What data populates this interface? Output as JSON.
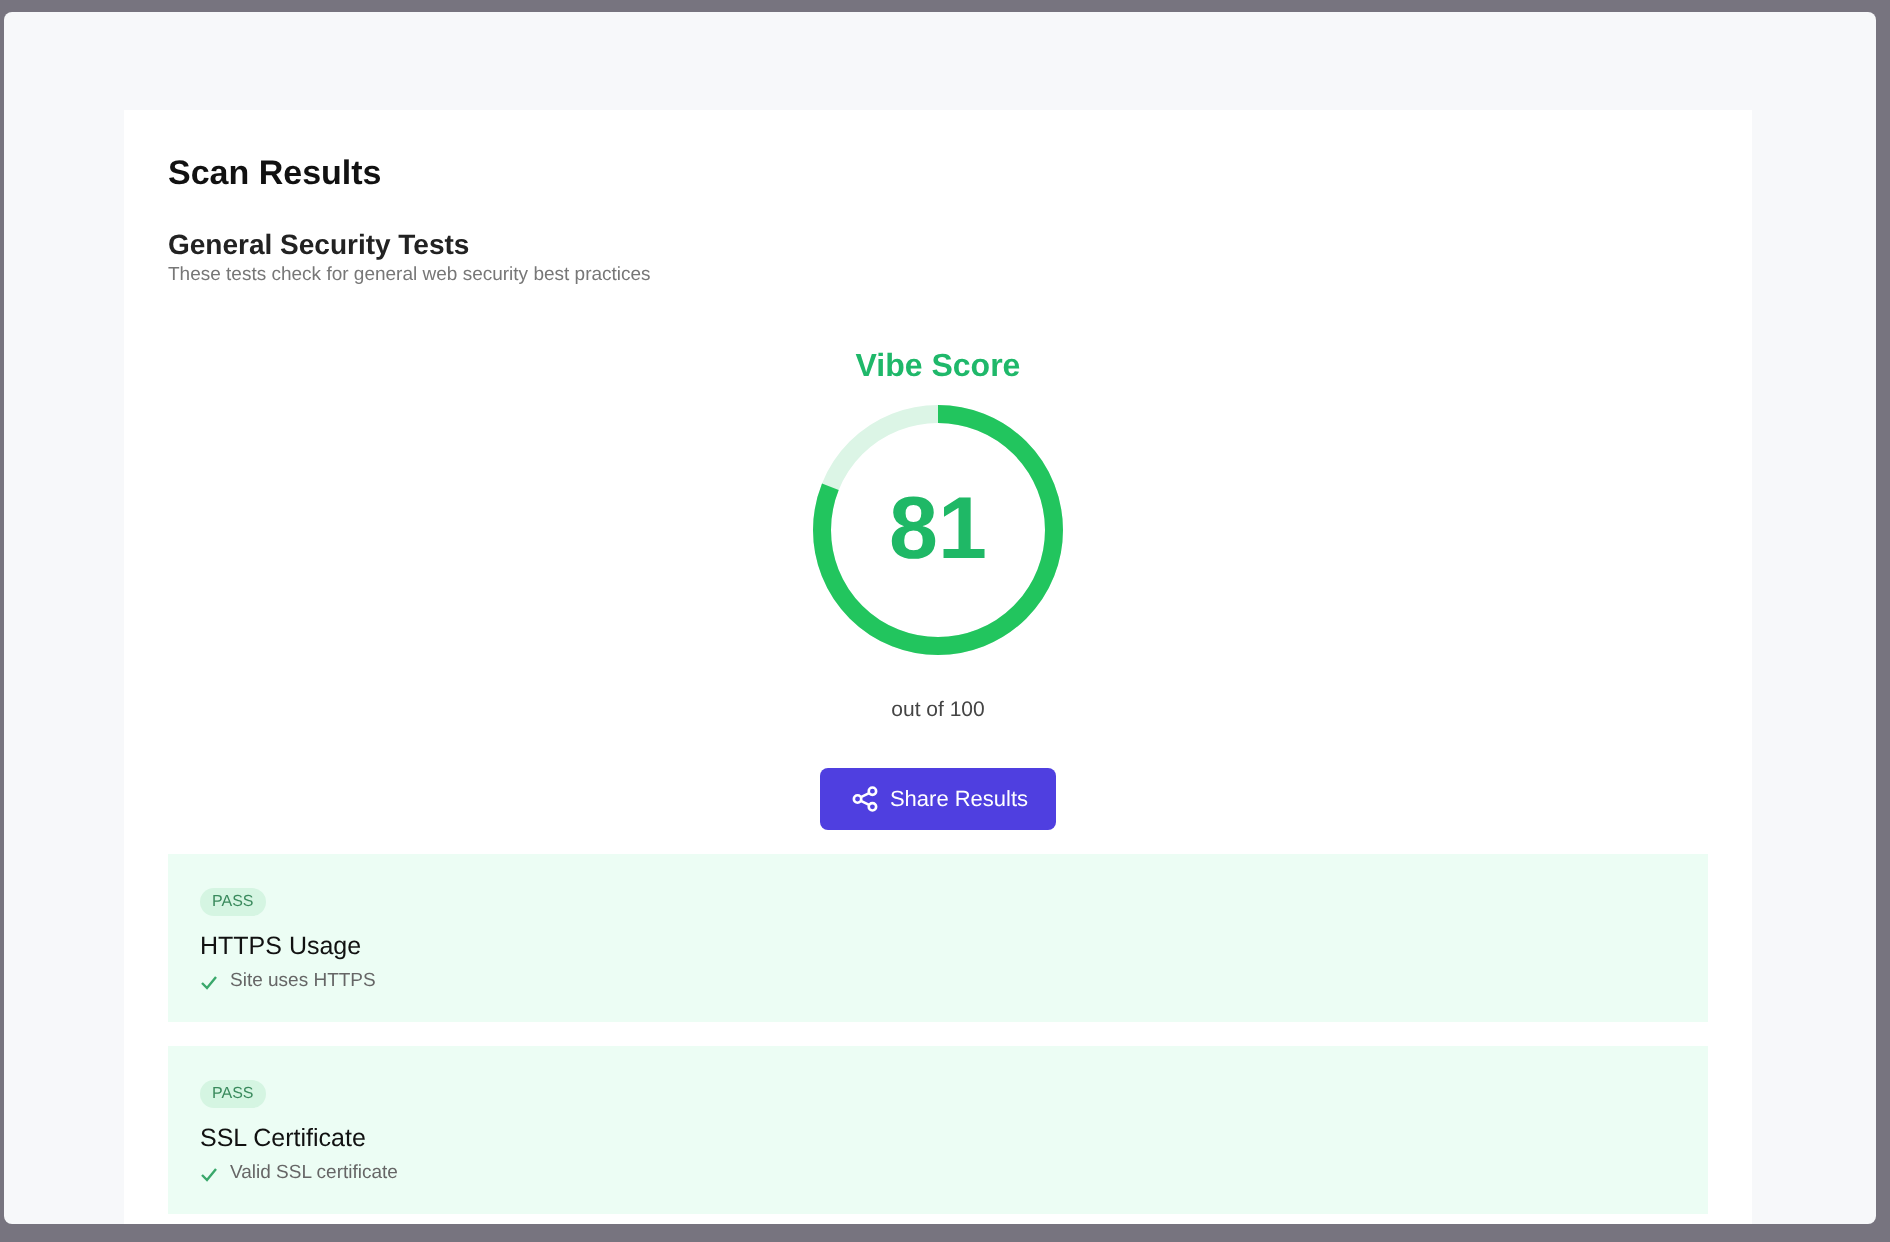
{
  "page": {
    "title": "Scan Results"
  },
  "section": {
    "title": "General Security Tests",
    "description": "These tests check for general web security best practices"
  },
  "score": {
    "label": "Vibe Score",
    "value": "81",
    "level": 0.81,
    "caption": "out of 100"
  },
  "share_button": {
    "label": "Share Results"
  },
  "tests": [
    {
      "status": "PASS",
      "title": "HTTPS Usage",
      "detail": "Site uses HTTPS"
    },
    {
      "status": "PASS",
      "title": "SSL Certificate",
      "detail": "Valid SSL certificate"
    }
  ]
}
